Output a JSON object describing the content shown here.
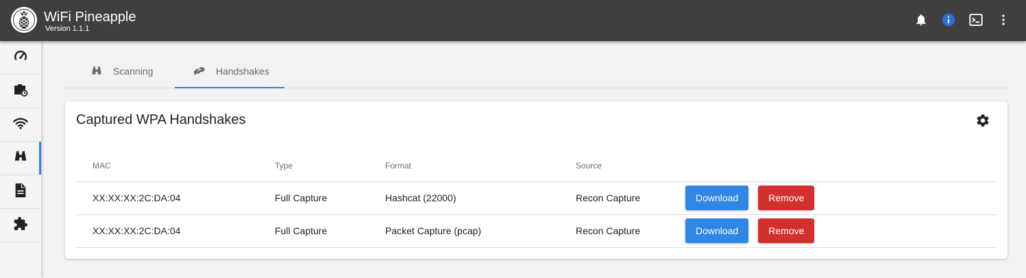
{
  "app": {
    "title": "WiFi Pineapple",
    "version": "Version 1.1.1"
  },
  "topbar_icons": [
    "bell-icon",
    "info-icon",
    "terminal-icon",
    "more-vert-icon"
  ],
  "sidebar": {
    "items": [
      {
        "icon": "speedometer-icon",
        "active": false
      },
      {
        "icon": "briefcase-clock-icon",
        "active": false
      },
      {
        "icon": "wifi-icon",
        "active": false
      },
      {
        "icon": "binoculars-icon",
        "active": true
      },
      {
        "icon": "document-icon",
        "active": false
      },
      {
        "icon": "puzzle-icon",
        "active": false
      }
    ]
  },
  "tabs": [
    {
      "label": "Scanning",
      "icon": "binoculars-icon",
      "active": false
    },
    {
      "label": "Handshakes",
      "icon": "handshake-icon",
      "active": true
    }
  ],
  "card": {
    "title": "Captured WPA Handshakes",
    "columns": [
      "MAC",
      "Type",
      "Format",
      "Source",
      ""
    ],
    "rows": [
      {
        "mac": "XX:XX:XX:2C:DA:04",
        "type": "Full Capture",
        "format": "Hashcat (22000)",
        "source": "Recon Capture",
        "download_label": "Download",
        "remove_label": "Remove"
      },
      {
        "mac": "XX:XX:XX:2C:DA:04",
        "type": "Full Capture",
        "format": "Packet Capture (pcap)",
        "source": "Recon Capture",
        "download_label": "Download",
        "remove_label": "Remove"
      }
    ]
  },
  "colors": {
    "topbar": "#3f3f3f",
    "accent": "#2f80ed",
    "download": "#2f86e4",
    "remove": "#d32f2f",
    "info_icon": "#2c6fd6"
  }
}
